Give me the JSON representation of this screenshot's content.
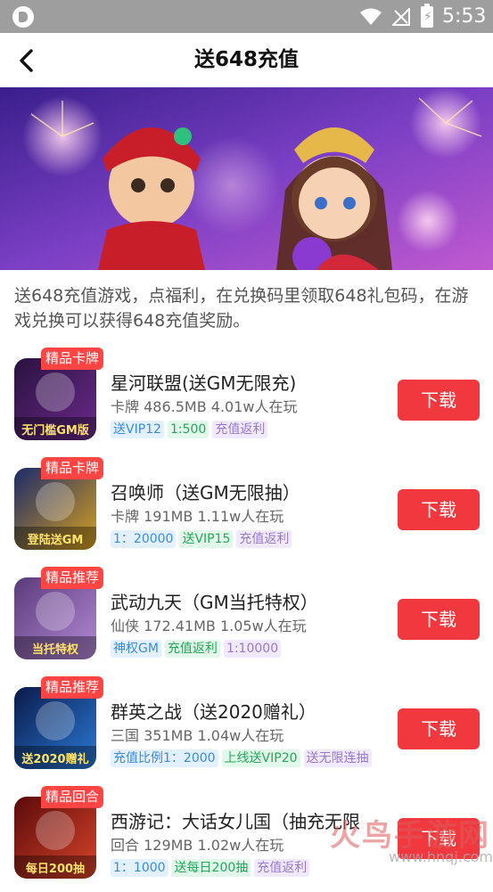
{
  "status_bar": {
    "time": "5:53",
    "battery_glyph": "⚡"
  },
  "header": {
    "title": "送648充值",
    "back_icon": "chevron-left-icon"
  },
  "description": "送648充值游戏，点福利，在兑换码里领取648礼包码，在游戏兑换可以获得648充值奖励。",
  "download_label": "下载",
  "games": [
    {
      "badge": "精品卡牌",
      "name": "星河联盟(送GM无限充)",
      "meta": "卡牌  486.5MB 4.01w人在玩",
      "thumb_text": "无门槛GM版",
      "tags": [
        {
          "text": "送VIP12",
          "color": "blue"
        },
        {
          "text": "1:500",
          "color": "green"
        },
        {
          "text": "充值返利",
          "color": "purple"
        }
      ]
    },
    {
      "badge": "精品卡牌",
      "name": "召唤师（送GM无限抽）",
      "meta": "卡牌 191MB 1.11w人在玩",
      "thumb_text": "登陆送GM",
      "tags": [
        {
          "text": "1：20000",
          "color": "blue"
        },
        {
          "text": "送VIP15",
          "color": "green"
        },
        {
          "text": "充值返利",
          "color": "purple"
        }
      ]
    },
    {
      "badge": "精品推荐",
      "name": "武动九天（GM当托特权）",
      "meta": "仙侠 172.41MB 1.05w人在玩",
      "thumb_text": "当托特权",
      "tags": [
        {
          "text": "神权GM",
          "color": "blue"
        },
        {
          "text": "充值返利",
          "color": "green"
        },
        {
          "text": "1:10000",
          "color": "purple"
        }
      ]
    },
    {
      "badge": "精品推荐",
      "name": "群英之战（送2020赠礼）",
      "meta": "三国 351MB 1.04w人在玩",
      "thumb_text": "送2020赠礼",
      "tags": [
        {
          "text": "充值比例1：2000",
          "color": "blue"
        },
        {
          "text": "上线送VIP20",
          "color": "green"
        },
        {
          "text": "送无限连抽",
          "color": "purple"
        }
      ]
    },
    {
      "badge": "精品回合",
      "name": "西游记：大话女儿国（抽充无限",
      "meta": "回合 129MB 1.02w人在玩",
      "thumb_text": "每日200抽",
      "tags": [
        {
          "text": "1：1000",
          "color": "blue"
        },
        {
          "text": "送每日200抽",
          "color": "green"
        },
        {
          "text": "充值返利",
          "color": "purple"
        }
      ]
    }
  ],
  "watermark": {
    "text": "火鸟手游网",
    "url": "www.hnqj.com"
  },
  "colors": {
    "accent": "#f1383f",
    "status_bar": "#9e9e9e"
  }
}
